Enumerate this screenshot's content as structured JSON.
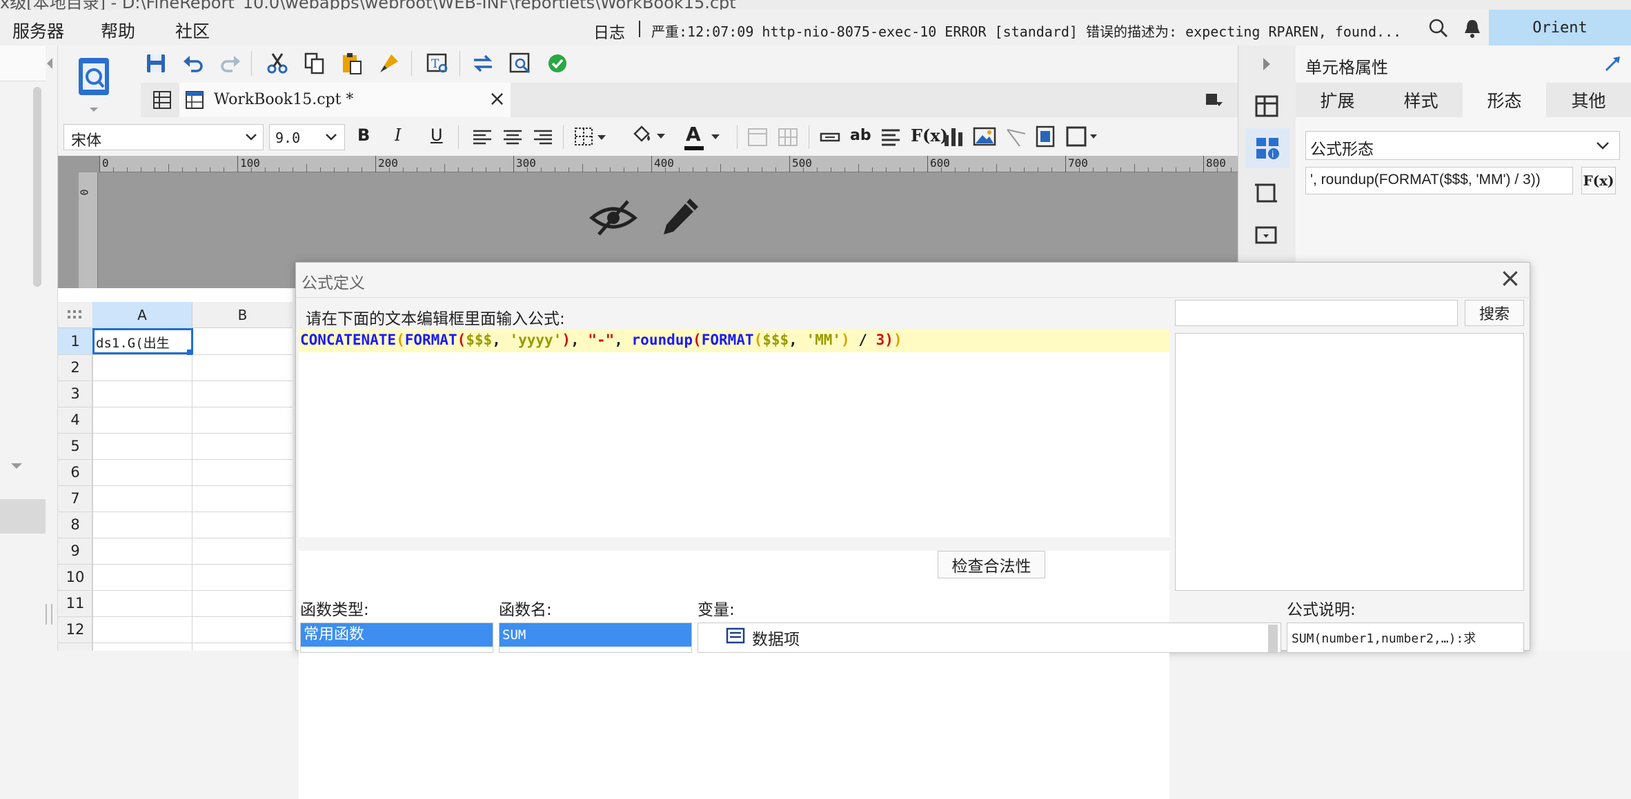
{
  "window": {
    "title_path": "ⅹ级[本地目录] - D:\\FineReport_10.0\\webapps\\webroot\\WEB-INF\\reportlets\\WorkBook15.cpt"
  },
  "menubar": {
    "items": [
      "服务器",
      "帮助",
      "社区"
    ],
    "log_label": "日志",
    "log_message": "严重:12:07:09 http-nio-8075-exec-10 ERROR [standard] 错误的描述为: expecting RPAREN, found...",
    "user": "Orient"
  },
  "file_tab": {
    "name": "WorkBook15.cpt *"
  },
  "format_bar": {
    "font_name": "宋体",
    "font_size": "9.0",
    "bold": "B",
    "italic": "I",
    "underline": "U",
    "text_color_glyph": "A",
    "ab_glyph": "ab",
    "fx_glyph": "F(x)"
  },
  "ruler": {
    "ticks": [
      "0",
      "100",
      "200",
      "300",
      "400",
      "500",
      "600",
      "700",
      "800"
    ],
    "vertical_tick": "0"
  },
  "grid": {
    "columns": [
      "A",
      "B"
    ],
    "rows": [
      "1",
      "2",
      "3",
      "4",
      "5",
      "6",
      "7",
      "8",
      "9",
      "10",
      "11",
      "12"
    ],
    "cell_a1": "ds1.G(出生"
  },
  "right_panel": {
    "title": "单元格属性",
    "tabs": [
      "扩展",
      "样式",
      "形态",
      "其他"
    ],
    "active_tab": "形态",
    "form_type": "公式形态",
    "formula_preview": "', roundup(FORMAT($$$, 'MM') / 3))",
    "fx_button": "F(x)"
  },
  "dialog": {
    "title": "公式定义",
    "instruction": "请在下面的文本编辑框里面输入公式:",
    "formula_tokens": [
      {
        "text": "CONCATENATE",
        "color": "#1a1aff"
      },
      {
        "text": "(",
        "color": "#e0a000"
      },
      {
        "text": "FORMAT",
        "color": "#1a1aff"
      },
      {
        "text": "(",
        "color": "#d01010"
      },
      {
        "text": "$$$",
        "color": "#9a9a00"
      },
      {
        "text": ", ",
        "color": "#222222"
      },
      {
        "text": "'yyyy'",
        "color": "#9a9a00"
      },
      {
        "text": ")",
        "color": "#d01010"
      },
      {
        "text": ", ",
        "color": "#222222"
      },
      {
        "text": "\"-\"",
        "color": "#d01010"
      },
      {
        "text": ", ",
        "color": "#222222"
      },
      {
        "text": "roundup",
        "color": "#1a1aff"
      },
      {
        "text": "(",
        "color": "#d01010"
      },
      {
        "text": "FORMAT",
        "color": "#1a1aff"
      },
      {
        "text": "(",
        "color": "#e0a000"
      },
      {
        "text": "$$$",
        "color": "#9a9a00"
      },
      {
        "text": ", ",
        "color": "#222222"
      },
      {
        "text": "'MM'",
        "color": "#9a9a00"
      },
      {
        "text": ")",
        "color": "#e0a000"
      },
      {
        "text": " / ",
        "color": "#222222"
      },
      {
        "text": "3",
        "color": "#d01010"
      },
      {
        "text": ")",
        "color": "#d01010"
      },
      {
        "text": ")",
        "color": "#e0a000"
      }
    ],
    "search_button": "搜索",
    "search_placeholder": "",
    "check_button": "检查合法性",
    "function_type_label": "函数类型:",
    "function_name_label": "函数名:",
    "variable_label": "变量:",
    "description_label": "公式说明:",
    "function_type_selected": "常用函数",
    "function_name_selected": "SUM",
    "variable_item": "数据项",
    "description_text": "SUM(number1,number2,…):求"
  },
  "colors": {
    "accent_blue": "#1f6fd1",
    "selection_blue": "#3d8ef0",
    "formula_bg": "#fffbc2",
    "orient_bg": "#b9dcf7",
    "ok_green": "#2aa845"
  }
}
